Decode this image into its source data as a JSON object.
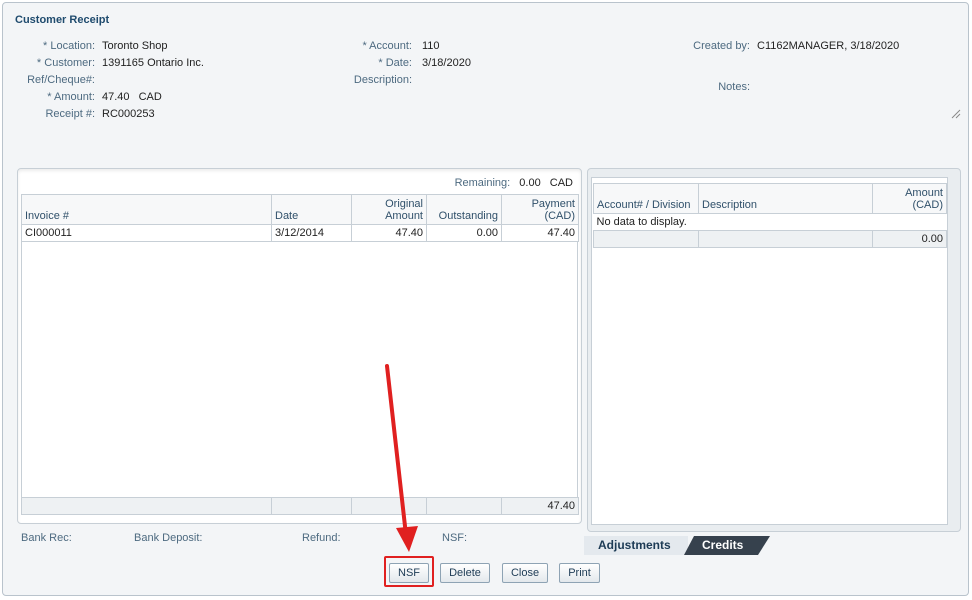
{
  "form": {
    "title": "Customer Receipt",
    "location_label": "* Location:",
    "location_value": "Toronto Shop",
    "customer_label": "* Customer:",
    "customer_value": "1391165 Ontario Inc.",
    "ref_label": "Ref/Cheque#:",
    "ref_value": "",
    "amount_label": "* Amount:",
    "amount_value": "47.40",
    "amount_currency": "CAD",
    "receipt_label": "Receipt #:",
    "receipt_value": "RC000253",
    "account_label": "* Account:",
    "account_value": "110",
    "date_label": "* Date:",
    "date_value": "3/18/2020",
    "description_label": "Description:",
    "description_value": "",
    "created_by_label": "Created by:",
    "created_by_value": "C1162MANAGER, 3/18/2020",
    "notes_label": "Notes:",
    "notes_value": ""
  },
  "invoices": {
    "remaining_label": "Remaining:",
    "remaining_value": "0.00",
    "remaining_currency": "CAD",
    "columns": {
      "invoice": "Invoice #",
      "date": "Date",
      "original_1": "Original",
      "original_2": "Amount",
      "outstanding": "Outstanding",
      "payment_1": "Payment",
      "payment_2": "(CAD)"
    },
    "rows": [
      {
        "invoice": "CI000011",
        "date": "3/12/2014",
        "original": "47.40",
        "outstanding": "0.00",
        "payment": "47.40"
      }
    ],
    "total_payment": "47.40"
  },
  "adjustments": {
    "columns": {
      "account": "Account# / Division",
      "description": "Description",
      "amount_1": "Amount",
      "amount_2": "(CAD)"
    },
    "empty_text": "No data to display.",
    "total_amount": "0.00"
  },
  "tabs": {
    "adjustments": "Adjustments",
    "credits": "Credits"
  },
  "footer": {
    "bank_rec_label": "Bank Rec:",
    "bank_deposit_label": "Bank Deposit:",
    "refund_label": "Refund:",
    "nsf_label": "NSF:"
  },
  "buttons": {
    "nsf": "NSF",
    "delete": "Delete",
    "close": "Close",
    "print": "Print"
  },
  "annotation": {
    "arrow_color": "#e02020"
  }
}
